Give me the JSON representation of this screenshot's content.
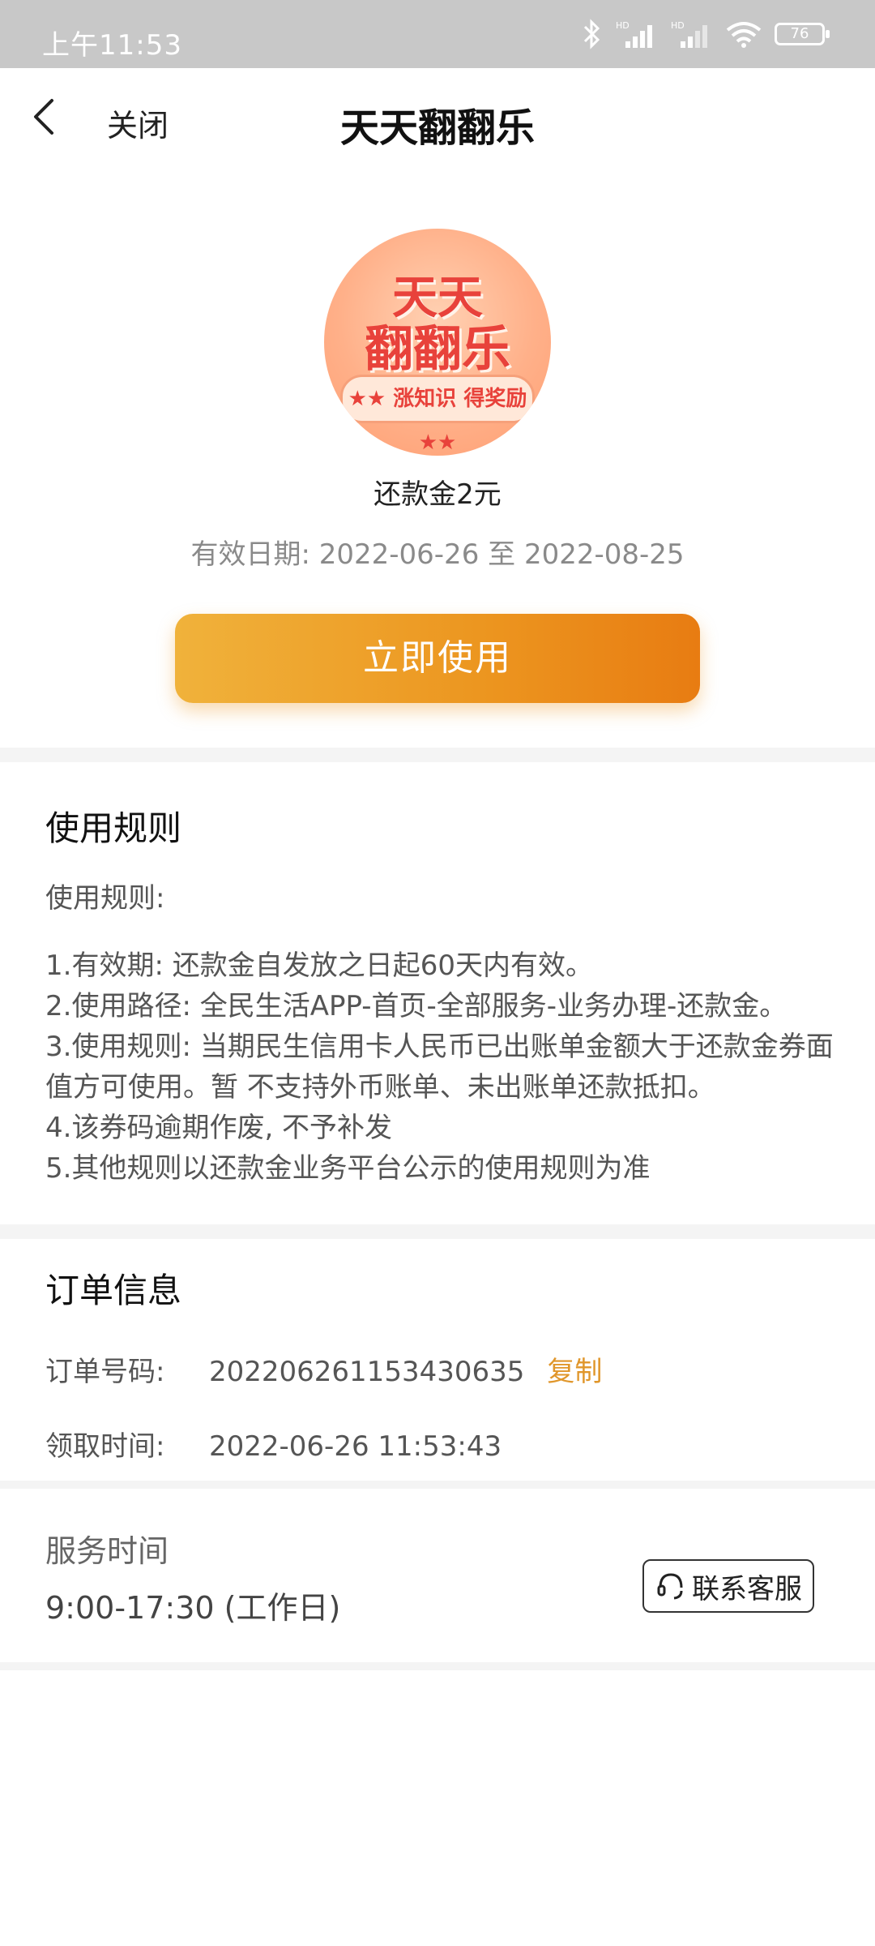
{
  "status_bar": {
    "time": "上午11:53",
    "battery": "76",
    "hd1": "HD",
    "hd2": "HD"
  },
  "nav": {
    "close": "关闭",
    "title": "天天翻翻乐"
  },
  "coupon": {
    "image_line1": "天天",
    "image_line2": "翻翻乐",
    "image_ribbon": "★★ 涨知识 得奖励 ★★",
    "name": "还款金2元",
    "validity": "有效日期:  2022-06-26 至 2022-08-25",
    "use_button": "立即使用"
  },
  "rules": {
    "title": "使用规则",
    "subtitle": "使用规则:",
    "items": [
      "1.有效期: 还款金自发放之日起60天内有效。",
      "2.使用路径: 全民生活APP-首页-全部服务-业务办理-还款金。",
      "3.使用规则: 当期民生信用卡人民币已出账单金额大于还款金券面值方可使用。暂 不支持外币账单、未出账单还款抵扣。",
      "4.该券码逾期作废, 不予补发",
      "5.其他规则以还款金业务平台公示的使用规则为准"
    ]
  },
  "order": {
    "title": "订单信息",
    "number_label": "订单号码:",
    "number_value": "202206261153430635",
    "copy": "复制",
    "time_label": "领取时间:",
    "time_value": "2022-06-26 11:53:43"
  },
  "service": {
    "label": "服务时间",
    "hours": "9:00-17:30 (工作日)",
    "contact": "联系客服"
  },
  "colors": {
    "accent": "#e0962a",
    "button_start": "#f0b23b",
    "button_end": "#e87c12",
    "divider": "#f4f4f4"
  }
}
